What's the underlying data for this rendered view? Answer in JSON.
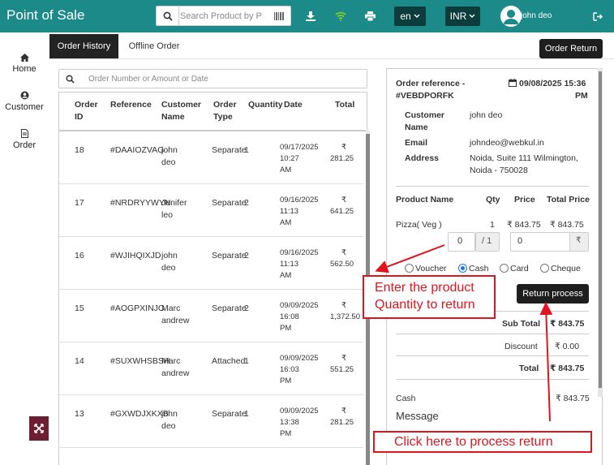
{
  "app": {
    "title": "Point of Sale"
  },
  "header": {
    "search_placeholder": "Search Product by Pr",
    "language": "en",
    "currency": "INR",
    "username": "john deo"
  },
  "sidebar": {
    "items": [
      {
        "label": "Home"
      },
      {
        "label": "Customer"
      },
      {
        "label": "Order"
      }
    ]
  },
  "tabs": [
    {
      "label": "Order History"
    },
    {
      "label": "Offline Order"
    }
  ],
  "order_return_button": "Order Return",
  "order_search_placeholder": "Order Number or Amount or Date",
  "table": {
    "headers": {
      "id1": "Order",
      "id2": "ID",
      "reference": "Reference",
      "customer1": "Customer",
      "customer2": "Name",
      "type1": "Order",
      "type2": "Type",
      "quantity": "Quantity",
      "date": "Date",
      "total": "Total"
    },
    "rows": [
      {
        "id": "18",
        "reference": "#DAAIOZVAG",
        "name1": "john",
        "name2": "deo",
        "type": "Separate",
        "qty": "1",
        "date1": "09/17/2025",
        "date2": "10:27",
        "date3": "AM",
        "cur": "₹",
        "total": "281.25"
      },
      {
        "id": "17",
        "reference": "#NRDRYYWYN",
        "name1": "Jenifer",
        "name2": "leo",
        "type": "Separate",
        "qty": "2",
        "date1": "09/16/2025",
        "date2": "11:13",
        "date3": "AM",
        "cur": "₹",
        "total": "641.25"
      },
      {
        "id": "16",
        "reference": "#WJIHQIXJD",
        "name1": "john",
        "name2": "deo",
        "type": "Separate",
        "qty": "2",
        "date1": "09/16/2025",
        "date2": "11:13",
        "date3": "AM",
        "cur": "₹",
        "total": "562.50"
      },
      {
        "id": "15",
        "reference": "#AOGPXINJO",
        "name1": "Marc",
        "name2": "andrew",
        "type": "Separate",
        "qty": "2",
        "date1": "09/09/2025",
        "date2": "16:08",
        "date3": "PM",
        "cur": "₹",
        "total": "1,372.50"
      },
      {
        "id": "14",
        "reference": "#SUXWHSBSH",
        "name1": "Marc",
        "name2": "andrew",
        "type": "Attached",
        "qty": "1",
        "date1": "09/09/2025",
        "date2": "16:03",
        "date3": "PM",
        "cur": "₹",
        "total": "551.25"
      },
      {
        "id": "13",
        "reference": "#GXWDJXKXB",
        "name1": "john",
        "name2": "deo",
        "type": "Separate",
        "qty": "1",
        "date1": "09/09/2025",
        "date2": "13:38",
        "date3": "PM",
        "cur": "₹",
        "total": "281.25"
      }
    ]
  },
  "detail": {
    "ref_label": "Order reference -",
    "ref_value": "#VEBDPORFK",
    "date": "09/08/2025 15:36",
    "time_suffix": "PM",
    "customer_label1": "Customer",
    "customer_label2": "Name",
    "customer_value": "john deo",
    "email_label": "Email",
    "email_value": "johndeo@webkul.in",
    "address_label": "Address",
    "address_line1": "Noida, Suite 111 Wilmington,",
    "address_line2": "Noida - 750028",
    "col_product": "Product Name",
    "col_qty": "Qty",
    "col_price": "Price",
    "col_total": "Total Price",
    "product": "Pizza( Veg )",
    "qty": "1",
    "price": "₹ 843.75",
    "total_price": "₹ 843.75",
    "return_qty": "0",
    "qty_max": "/ 1",
    "return_amount": "0",
    "rupee": "₹",
    "payment_options": [
      "Voucher",
      "Cash",
      "Card",
      "Cheque"
    ],
    "selected_payment": "Cash",
    "return_process_button": "Return process",
    "subtotal_label": "Sub Total",
    "subtotal_value": "₹ 843.75",
    "discount_label": "Discount",
    "discount_value": "₹ 0.00",
    "total_label": "Total",
    "total_value": "₹ 843.75",
    "cash_label": "Cash",
    "cash_value": "₹ 843.75",
    "message_label": "Message"
  },
  "annotations": {
    "qty_note_line1": "Enter the product",
    "qty_note_line2": "Quantity to return",
    "process_note": "Click here to process return"
  },
  "colors": {
    "topbar": "#1d8a8a",
    "dark": "#1e1e1e",
    "callout": "#e0141e"
  }
}
